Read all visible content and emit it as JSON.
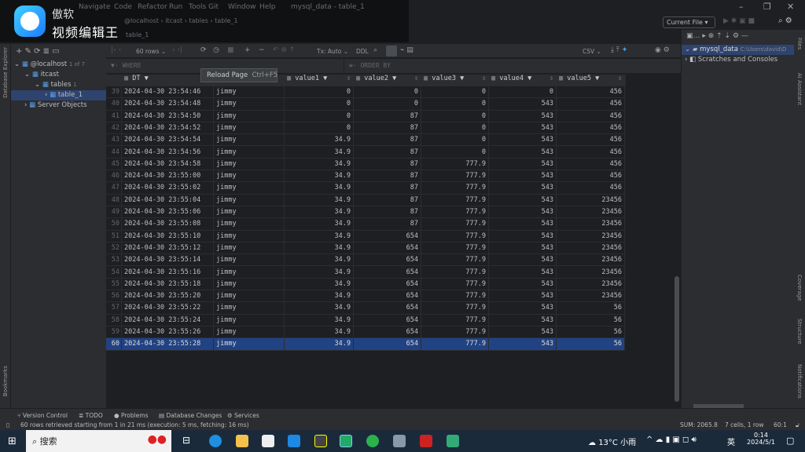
{
  "watermark": {
    "line1": "傲软",
    "line2": "视频编辑王"
  },
  "menu": [
    "Navigate",
    "Code",
    "Refactor",
    "Run",
    "Tools",
    "Git",
    "Window",
    "Help"
  ],
  "window_title": "mysql_data - table_1",
  "breadcrumb": [
    "@localhost",
    "itcast",
    "tables",
    "table_1"
  ],
  "editor_tab": "table_1",
  "run_config": "Current File",
  "db_explorer": {
    "strip_label": "Database Explorer",
    "tree": [
      {
        "label": "@localhost",
        "badge": "1 of 7",
        "depth": 0
      },
      {
        "label": "itcast",
        "depth": 1
      },
      {
        "label": "tables",
        "badge": "1",
        "depth": 2
      },
      {
        "label": "table_1",
        "depth": 3,
        "selected": true
      },
      {
        "label": "Server Objects",
        "depth": 1
      }
    ]
  },
  "grid_toolbar": {
    "rows": "60 rows",
    "tx": "Tx: Auto",
    "ddl": "DDL",
    "export": "CSV"
  },
  "tooltip": {
    "label": "Reload Page",
    "shortcut": "Ctrl+F5"
  },
  "filter": {
    "where": "WHERE",
    "order_by": "ORDER BY"
  },
  "columns": [
    "DT",
    "",
    "value1",
    "value2",
    "value3",
    "value4",
    "value5"
  ],
  "rows": [
    [
      39,
      "2024-04-30 23:54:46",
      "jimmy",
      "0",
      "0",
      "0",
      "0",
      "456"
    ],
    [
      40,
      "2024-04-30 23:54:48",
      "jimmy",
      "0",
      "0",
      "0",
      "543",
      "456"
    ],
    [
      41,
      "2024-04-30 23:54:50",
      "jimmy",
      "0",
      "87",
      "0",
      "543",
      "456"
    ],
    [
      42,
      "2024-04-30 23:54:52",
      "jimmy",
      "0",
      "87",
      "0",
      "543",
      "456"
    ],
    [
      43,
      "2024-04-30 23:54:54",
      "jimmy",
      "34.9",
      "87",
      "0",
      "543",
      "456"
    ],
    [
      44,
      "2024-04-30 23:54:56",
      "jimmy",
      "34.9",
      "87",
      "0",
      "543",
      "456"
    ],
    [
      45,
      "2024-04-30 23:54:58",
      "jimmy",
      "34.9",
      "87",
      "777.9",
      "543",
      "456"
    ],
    [
      46,
      "2024-04-30 23:55:00",
      "jimmy",
      "34.9",
      "87",
      "777.9",
      "543",
      "456"
    ],
    [
      47,
      "2024-04-30 23:55:02",
      "jimmy",
      "34.9",
      "87",
      "777.9",
      "543",
      "456"
    ],
    [
      48,
      "2024-04-30 23:55:04",
      "jimmy",
      "34.9",
      "87",
      "777.9",
      "543",
      "23456"
    ],
    [
      49,
      "2024-04-30 23:55:06",
      "jimmy",
      "34.9",
      "87",
      "777.9",
      "543",
      "23456"
    ],
    [
      50,
      "2024-04-30 23:55:08",
      "jimmy",
      "34.9",
      "87",
      "777.9",
      "543",
      "23456"
    ],
    [
      51,
      "2024-04-30 23:55:10",
      "jimmy",
      "34.9",
      "654",
      "777.9",
      "543",
      "23456"
    ],
    [
      52,
      "2024-04-30 23:55:12",
      "jimmy",
      "34.9",
      "654",
      "777.9",
      "543",
      "23456"
    ],
    [
      53,
      "2024-04-30 23:55:14",
      "jimmy",
      "34.9",
      "654",
      "777.9",
      "543",
      "23456"
    ],
    [
      54,
      "2024-04-30 23:55:16",
      "jimmy",
      "34.9",
      "654",
      "777.9",
      "543",
      "23456"
    ],
    [
      55,
      "2024-04-30 23:55:18",
      "jimmy",
      "34.9",
      "654",
      "777.9",
      "543",
      "23456"
    ],
    [
      56,
      "2024-04-30 23:55:20",
      "jimmy",
      "34.9",
      "654",
      "777.9",
      "543",
      "23456"
    ],
    [
      57,
      "2024-04-30 23:55:22",
      "jimmy",
      "34.9",
      "654",
      "777.9",
      "543",
      "56"
    ],
    [
      58,
      "2024-04-30 23:55:24",
      "jimmy",
      "34.9",
      "654",
      "777.9",
      "543",
      "56"
    ],
    [
      59,
      "2024-04-30 23:55:26",
      "jimmy",
      "34.9",
      "654",
      "777.9",
      "543",
      "56"
    ],
    [
      60,
      "2024-04-30 23:55:28",
      "jimmy",
      "34.9",
      "654",
      "777.9",
      "543",
      "56"
    ]
  ],
  "selected_row": 60,
  "project": {
    "root": "mysql_data",
    "root_path": "C:\\Users\\david\\D",
    "scratches": "Scratches and Consoles"
  },
  "right_strip": [
    "Files",
    "AI Assistant",
    "Coverage",
    "Structure",
    "Notifications"
  ],
  "left_bottom_strip": "Bookmarks",
  "bottom_tabs": [
    "Version Control",
    "TODO",
    "Problems",
    "Database Changes",
    "Services"
  ],
  "status": {
    "message": "60 rows retrieved starting from 1 in 21 ms (execution: 5 ms, fetching: 16 ms)",
    "sum": "SUM: 2065.8",
    "cells": "7 cells, 1 row",
    "pos": "60:1"
  },
  "taskbar": {
    "search": "搜索",
    "weather": "13°C 小雨",
    "ime": "英",
    "time": "0:14",
    "date": "2024/5/1"
  },
  "colors": {
    "selection": "#214283",
    "bg": "#1e1f22",
    "panel": "#2b2d30"
  }
}
